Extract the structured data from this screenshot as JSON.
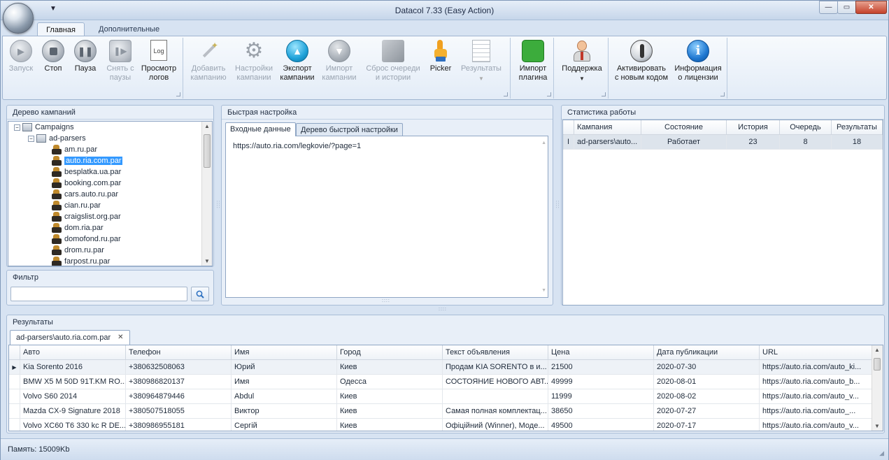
{
  "window": {
    "title": "Datacol 7.33 (Easy Action)",
    "qat_arrow": "▼",
    "minimize": "—",
    "restore": "▭",
    "close": "✕"
  },
  "ribbon_tabs": [
    {
      "label": "Главная",
      "active": true
    },
    {
      "label": "Дополнительные",
      "active": false
    }
  ],
  "ribbon": {
    "run": {
      "l1": "Запуск",
      "l2": "",
      "icon": "play-icon"
    },
    "stop": {
      "l1": "Стоп",
      "l2": "",
      "icon": "stop-icon"
    },
    "pause": {
      "l1": "Пауза",
      "l2": "",
      "icon": "pause-icon"
    },
    "unpause": {
      "l1": "Снять с",
      "l2": "паузы",
      "icon": "unpause-icon"
    },
    "logs": {
      "l1": "Просмотр",
      "l2": "логов",
      "icon": "log-document-icon",
      "glyph": "Log"
    },
    "add_campaign": {
      "l1": "Добавить",
      "l2": "кампанию",
      "icon": "magic-wand-icon"
    },
    "campaign_settings": {
      "l1": "Настройки",
      "l2": "кампании",
      "icon": "gear-icon"
    },
    "export_campaign": {
      "l1": "Экспорт",
      "l2": "кампании",
      "icon": "export-arrow-icon"
    },
    "import_campaign": {
      "l1": "Импорт",
      "l2": "кампании",
      "icon": "import-arrow-icon"
    },
    "reset_queue": {
      "l1": "Сброс очереди",
      "l2": "и истории",
      "icon": "reset-history-icon"
    },
    "picker": {
      "l1": "Picker",
      "l2": "",
      "icon": "pointer-hand-icon"
    },
    "results": {
      "l1": "Результаты",
      "l2": "",
      "icon": "results-table-icon"
    },
    "import_plugin": {
      "l1": "Импорт",
      "l2": "плагина",
      "icon": "puzzle-icon"
    },
    "support": {
      "l1": "Поддержка",
      "l2": "",
      "icon": "support-person-icon"
    },
    "activate": {
      "l1": "Активировать",
      "l2": "с новым кодом",
      "icon": "key-icon"
    },
    "license_info": {
      "l1": "Информация",
      "l2": "о лицензии",
      "icon": "info-icon",
      "glyph": "i"
    }
  },
  "campaign_tree": {
    "title": "Дерево кампаний",
    "root": "Campaigns",
    "folder": "ad-parsers",
    "items": [
      "am.ru.par",
      "auto.ria.com.par",
      "besplatka.ua.par",
      "booking.com.par",
      "cars.auto.ru.par",
      "cian.ru.par",
      "craigslist.org.par",
      "dom.ria.par",
      "domofond.ru.par",
      "drom.ru.par",
      "farpost.ru.par"
    ],
    "selected": "auto.ria.com.par"
  },
  "filter": {
    "title": "Фильтр",
    "value": ""
  },
  "quick_settings": {
    "title": "Быстрая настройка",
    "tabs": [
      "Входные данные",
      "Дерево быстрой настройки"
    ],
    "input_text": "https://auto.ria.com/legkovie/?page=1"
  },
  "stats": {
    "title": "Статистика работы",
    "columns": [
      "Кампания",
      "Состояние",
      "История",
      "Очередь",
      "Результаты"
    ],
    "rows": [
      {
        "marker": "I",
        "campaign": "ad-parsers\\auto...",
        "state": "Работает",
        "history": "23",
        "queue": "8",
        "results": "18"
      }
    ]
  },
  "results": {
    "title": "Результаты",
    "tab": "ad-parsers\\auto.ria.com.par",
    "columns": [
      "Авто",
      "Телефон",
      "Имя",
      "Город",
      "Текст объявления",
      "Цена",
      "Дата публикации",
      "URL"
    ],
    "rows": [
      [
        "Kia Sorento 2016",
        "+380632508063",
        "Юрий",
        "Киев",
        "Продам KIA SORENTO в и...",
        "21500",
        "2020-07-30",
        "https://auto.ria.com/auto_ki..."
      ],
      [
        "BMW X5 M 50D 91T.KM RO...",
        "+380986820137",
        "Имя",
        "Одесса",
        "СОСТОЯНИЕ НОВОГО АВТ...",
        "49999",
        "2020-08-01",
        "https://auto.ria.com/auto_b..."
      ],
      [
        "Volvo S60 2014",
        "+380964879446",
        "Abdul",
        "Киев",
        "",
        "11999",
        "2020-08-02",
        "https://auto.ria.com/auto_v..."
      ],
      [
        "Mazda CX-9 Signature 2018",
        "+380507518055",
        "Виктор",
        "Киев",
        "Самая полная комплектац...",
        "38650",
        "2020-07-27",
        "https://auto.ria.com/auto_..."
      ],
      [
        "Volvo XC60 T6 330 kc R DE...",
        "+380986955181",
        "Сергій",
        "Киев",
        "Офіційний (Winner), Моде...",
        "49500",
        "2020-07-17",
        "https://auto.ria.com/auto_v..."
      ]
    ]
  },
  "status_bar": {
    "memory": "Память: 15009Kb"
  }
}
